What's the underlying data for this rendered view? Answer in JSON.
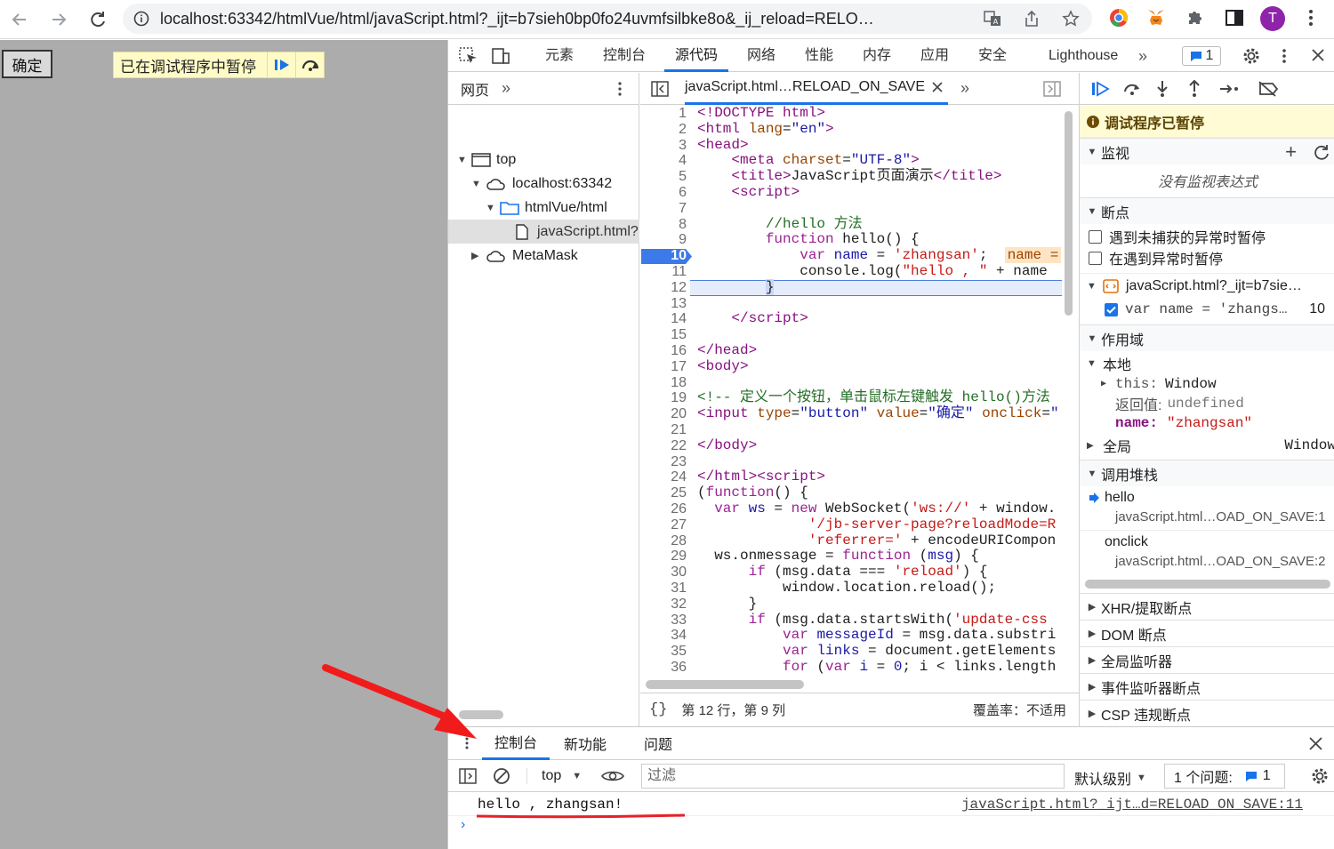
{
  "browser": {
    "url": "localhost:63342/htmlVue/html/javaScript.html?_ijt=b7sieh0bp0fo24uvmfsilbke8o&_ij_reload=RELO…",
    "profile_initial": "T",
    "profile_color": "#8e24aa"
  },
  "page": {
    "button_label": "确定",
    "paused_text": "已在调试程序中暂停"
  },
  "devtools": {
    "tabs": [
      "元素",
      "控制台",
      "源代码",
      "网络",
      "性能",
      "内存",
      "应用",
      "安全",
      "Lighthouse"
    ],
    "active_tab": "源代码",
    "issues_count": "1",
    "navigator": {
      "tab": "网页",
      "tree": [
        {
          "label": "top"
        },
        {
          "label": "localhost:63342"
        },
        {
          "label": "htmlVue/html"
        },
        {
          "label": "javaScript.html?"
        },
        {
          "label": "MetaMask"
        }
      ]
    },
    "editor": {
      "file_tab": "javaScript.html…RELOAD_ON_SAVE",
      "status_position": "第 12 行，第 9 列",
      "status_coverage": "覆盖率：不适用",
      "line_numbers": [
        "1",
        "2",
        "3",
        "4",
        "5",
        "6",
        "7",
        "8",
        "9",
        "10",
        "11",
        "12",
        "13",
        "14",
        "15",
        "16",
        "17",
        "18",
        "19",
        "20",
        "21",
        "22",
        "23",
        "24",
        "25",
        "26",
        "27",
        "28",
        "29",
        "30",
        "31",
        "32",
        "33",
        "34",
        "35",
        "36"
      ],
      "inline_value": "name ="
    },
    "debugger": {
      "paused_notice": "调试程序已暂停",
      "watch_title": "监视",
      "watch_empty": "没有监视表达式",
      "breakpoints_title": "断点",
      "bp_uncaught": "遇到未捕获的异常时暂停",
      "bp_caught": "在遇到异常时暂停",
      "bp_file": "javaScript.html?_ijt=b7sie…",
      "bp_code": "var name = 'zhangs…",
      "bp_line": "10",
      "scope_title": "作用域",
      "local_title": "本地",
      "scope_this_key": "this:",
      "scope_this_val": "Window",
      "scope_return_key": "返回值:",
      "scope_return_val": "undefined",
      "scope_name_key": "name:",
      "scope_name_val": "\"zhangsan\"",
      "global_title": "全局",
      "global_val": "Window",
      "callstack_title": "调用堆栈",
      "frames": [
        {
          "name": "hello",
          "loc": "javaScript.html…OAD_ON_SAVE:1"
        },
        {
          "name": "onclick",
          "loc": "javaScript.html…OAD_ON_SAVE:2"
        }
      ],
      "more_sections": [
        "XHR/提取断点",
        "DOM 断点",
        "全局监听器",
        "事件监听器断点",
        "CSP 违规断点"
      ]
    },
    "drawer": {
      "tabs": [
        "控制台",
        "新功能",
        "问题"
      ],
      "context": "top",
      "filter_placeholder": "过滤",
      "level": "默认级别",
      "issues_label": "1 个问题:",
      "issues_count": "1",
      "message": "hello , zhangsan!",
      "message_source": "javaScript.html?_ijt…d=RELOAD_ON_SAVE:11"
    }
  }
}
